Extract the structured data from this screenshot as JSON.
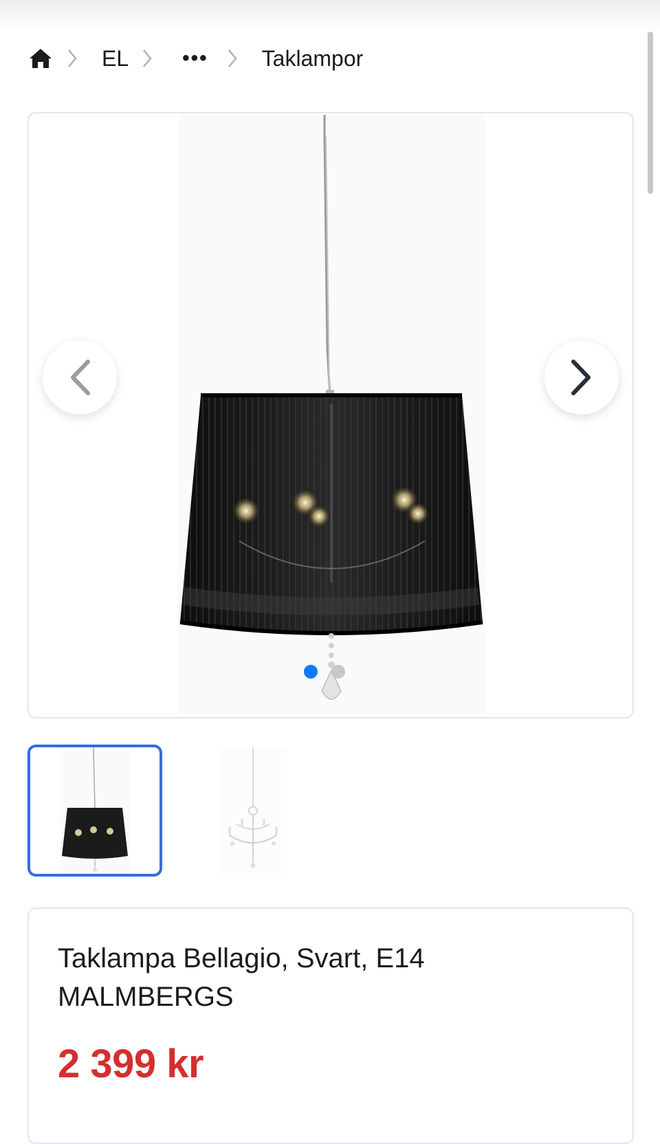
{
  "breadcrumb": {
    "home_icon": "home-icon",
    "items": [
      "EL",
      "•••",
      "Taklampor"
    ]
  },
  "gallery": {
    "prev_icon": "chevron-left-icon",
    "next_icon": "chevron-right-icon",
    "slide_count": 2,
    "active_slide": 1
  },
  "product": {
    "title_line1": "Taklampa Bellagio, Svart, E14",
    "title_line2": "MALMBERGS",
    "price": "2 399 kr"
  },
  "colors": {
    "price": "#d32f2f",
    "active_dot": "#0a7aff",
    "selected_thumb_border": "#2f6fe0",
    "lamp_shade": "#1a1a1a"
  }
}
